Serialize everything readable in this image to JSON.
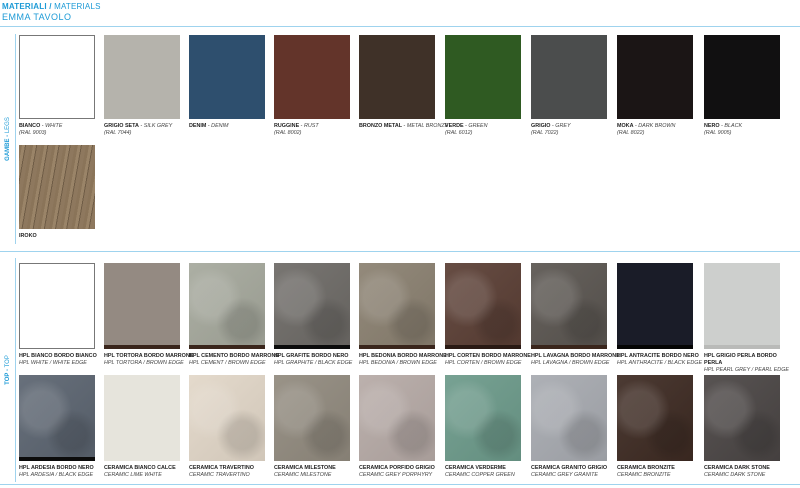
{
  "header": {
    "title_it": "MATERIALI",
    "slash": "/",
    "title_en": "MATERIALS",
    "subtitle": "EMMA TAVOLO"
  },
  "sections": [
    {
      "label_it": "GAMBE",
      "label_en": "LEGS",
      "items": [
        {
          "name": "BIANCO",
          "en": "WHITE",
          "ral": "(RAL 9003)",
          "color": "#ffffff",
          "border": "#777"
        },
        {
          "name": "GRIGIO SETA",
          "en": "SILK GREY",
          "ral": "(RAL 7044)",
          "color": "#b5b3ac"
        },
        {
          "name": "DENIM",
          "en": "DENIM",
          "ral": "",
          "color": "#2e4f6e"
        },
        {
          "name": "RUGGINE",
          "en": "RUST",
          "ral": "(RAL 8002)",
          "color": "#63342a"
        },
        {
          "name": "BRONZO METAL",
          "en": "METAL BRONZE",
          "ral": "",
          "color": "#3f3128"
        },
        {
          "name": "VERDE",
          "en": "GREEN",
          "ral": "(RAL 6012)",
          "color": "#2f5a22"
        },
        {
          "name": "GRIGIO",
          "en": "GREY",
          "ral": "(RAL 7022)",
          "color": "#4b4d4d"
        },
        {
          "name": "MOKA",
          "en": "DARK BROWN",
          "ral": "(RAL 8022)",
          "color": "#1b1515"
        },
        {
          "name": "NERO",
          "en": "BLACK",
          "ral": "(RAL 9005)",
          "color": "#111011"
        },
        {
          "name": "IROKO",
          "en": "",
          "ral": "",
          "color": "#8a7459",
          "wood": true
        }
      ]
    },
    {
      "label_it": "TOP",
      "label_en": "TOP",
      "items": [
        {
          "name": "HPL BIANCO BORDO BIANCO",
          "en": "HPL WHITE / WHITE EDGE",
          "color": "#ffffff",
          "border": "#777",
          "edge": "#ffffff"
        },
        {
          "name": "HPL TORTORA BORDO MARRONE",
          "en": "HPL TORTORA / BROWN EDGE",
          "color": "#948a82",
          "edge": "#3a261c"
        },
        {
          "name": "HPL CEMENTO BORDO MARRONE",
          "en": "HPL CEMENT / BROWN EDGE",
          "color": "#a5a89c",
          "edge": "#3a261c",
          "texture": true
        },
        {
          "name": "HPL GRAFITE BORDO NERO",
          "en": "HPL GRAPHITE / BLACK EDGE",
          "color": "#6d6a66",
          "edge": "#0c0c0c",
          "texture": true
        },
        {
          "name": "HPL BEDONIA BORDO MARRONE",
          "en": "HPL BEDONIA / BROWN EDGE",
          "color": "#8a8070",
          "edge": "#3a261c",
          "texture": true
        },
        {
          "name": "HPL CORTEN BORDO MARRONE",
          "en": "HPL CORTEN / BROWN EDGE",
          "color": "#5a3e34",
          "edge": "#2a1a14",
          "texture": true
        },
        {
          "name": "HPL LAVAGNA BORDO MARRONE",
          "en": "HPL LAVAGNA / BROWN EDGE",
          "color": "#5a5550",
          "edge": "#3a261c",
          "texture": true
        },
        {
          "name": "HPL ANTRACITE BORDO NERO",
          "en": "HPL ANTHRACITE / BLACK EDGE",
          "color": "#1a1c28",
          "edge": "#050505"
        },
        {
          "name": "HPL GRIGIO PERLA BORDO PERLA",
          "en": "HPL PEARL GREY / PEARL EDGE",
          "color": "#cdcfcd",
          "edge": "#b9bab8"
        },
        {
          "name": "HPL ARDESIA BORDO NERO",
          "en": "HPL ARDESIA / BLACK EDGE",
          "color": "#5b6470",
          "edge": "#0c0c0c",
          "texture": true
        },
        {
          "name": "CERAMICA BIANCO CALCE",
          "en": "CERAMIC LIME WHITE",
          "color": "#e6e4dc"
        },
        {
          "name": "CERAMICA TRAVERTINO",
          "en": "CERAMIC TRAVERTINO",
          "color": "#e2d7c8",
          "texture": true
        },
        {
          "name": "CERAMICA MILESTONE",
          "en": "CERAMIC MILESTONE",
          "color": "#918a7e",
          "texture": true
        },
        {
          "name": "CERAMICA PORFIDO GRIGIO",
          "en": "CERAMIC GREY PORPHYRY",
          "color": "#b6aaa6",
          "texture": true
        },
        {
          "name": "CERAMICA VERDERME",
          "en": "CERAMIC COPPER GREEN",
          "color": "#6c9a8a",
          "texture": true
        },
        {
          "name": "CERAMICA GRANITO GRIGIO",
          "en": "CERAMIC GREY GRANITE",
          "color": "#a7aab0",
          "texture": true
        },
        {
          "name": "CERAMICA BRONZITE",
          "en": "CERAMIC BRONZITE",
          "color": "#3d2a22",
          "texture": true
        },
        {
          "name": "CERAMICA DARK STONE",
          "en": "CERAMIC DARK STONE",
          "color": "#4a4544",
          "texture": true
        }
      ]
    }
  ]
}
